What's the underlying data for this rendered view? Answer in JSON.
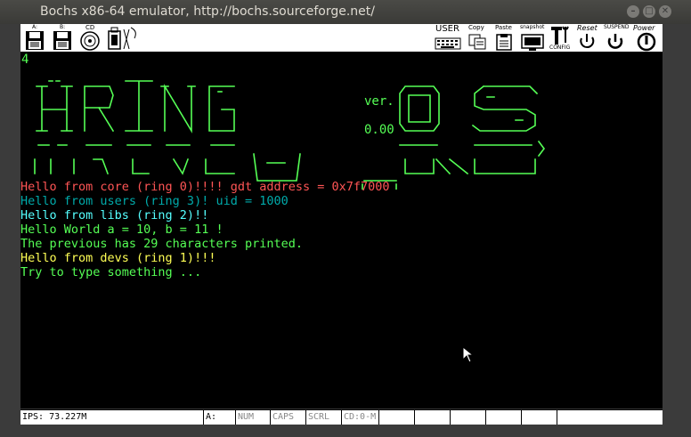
{
  "window": {
    "title": "Bochs x86-64 emulator, http://bochs.sourceforge.net/",
    "controls": {
      "minimize": "–",
      "maximize": "□",
      "close": "✕"
    }
  },
  "toolbar": {
    "left": [
      {
        "name": "floppy-a-icon",
        "label": "A:"
      },
      {
        "name": "floppy-b-icon",
        "label": "B:"
      },
      {
        "name": "cdrom-icon",
        "label": "CD"
      },
      {
        "name": "usb-icon",
        "label": ""
      },
      {
        "name": "mouse-icon",
        "label": ""
      }
    ],
    "right": [
      {
        "name": "user-icon",
        "label": "USER"
      },
      {
        "name": "copy-icon",
        "label": "Copy"
      },
      {
        "name": "paste-icon",
        "label": "Paste"
      },
      {
        "name": "snapshot-icon",
        "label": "snapshot"
      },
      {
        "name": "config-icon",
        "label": "CONFIG"
      },
      {
        "name": "reset-icon",
        "label": "Reset"
      },
      {
        "name": "suspend-icon",
        "label": "SUSPEND"
      },
      {
        "name": "power-icon",
        "label": "Power"
      }
    ]
  },
  "screen": {
    "top_char": "4",
    "version_label": "ver.",
    "version_number": "0.00",
    "lines": [
      {
        "text": "Hello from core (ring 0)!!!! gdt address = 0x7f7000",
        "color": "#ff5555"
      },
      {
        "text": "Hello from users (ring 3)! uid = 1000",
        "color": "#00aaaa"
      },
      {
        "text": "Hello from libs (ring 2)!!",
        "color": "#55ffff"
      },
      {
        "text": "Hello World a = 10, b = 11 !",
        "color": "#55ff55"
      },
      {
        "text": "The previous has 29 characters printed.",
        "color": "#55ff55"
      },
      {
        "text": "Hello from devs (ring 1)!!!",
        "color": "#ffff55"
      },
      {
        "text": "Try to type something ...",
        "color": "#55ff55"
      }
    ],
    "banner_color": "#55ff55"
  },
  "status": {
    "ips": "IPS: 73.227M",
    "drive": "A:",
    "num": "NUM",
    "caps": "CAPS",
    "scrl": "SCRL",
    "cd": "CD:0-M"
  }
}
